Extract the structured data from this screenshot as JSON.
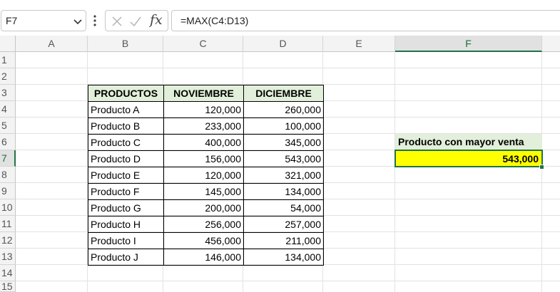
{
  "formula_bar": {
    "name_box": "F7",
    "fx_label": "fx",
    "formula": "=MAX(C4:D13)"
  },
  "columns": [
    "A",
    "B",
    "C",
    "D",
    "E",
    "F"
  ],
  "rows": [
    "1",
    "2",
    "3",
    "4",
    "5",
    "6",
    "7",
    "8",
    "9",
    "10",
    "11",
    "12",
    "13",
    "14",
    "15"
  ],
  "table": {
    "headers": [
      "PRODUCTOS",
      "NOVIEMBRE",
      "DICIEMBRE"
    ],
    "rows": [
      [
        "Producto A",
        "120,000",
        "260,000"
      ],
      [
        "Producto B",
        "233,000",
        "100,000"
      ],
      [
        "Producto C",
        "400,000",
        "345,000"
      ],
      [
        "Producto D",
        "156,000",
        "543,000"
      ],
      [
        "Producto E",
        "120,000",
        "321,000"
      ],
      [
        "Producto F",
        "145,000",
        "134,000"
      ],
      [
        "Producto G",
        "200,000",
        "54,000"
      ],
      [
        "Producto H",
        "256,000",
        "257,000"
      ],
      [
        "Producto I",
        "456,000",
        "211,000"
      ],
      [
        "Producto J",
        "146,000",
        "134,000"
      ]
    ]
  },
  "summary": {
    "label": "Producto con mayor venta",
    "value": "543,000"
  },
  "selection": {
    "cell": "F7",
    "column": "F",
    "row": "7"
  },
  "colors": {
    "header_fill": "#e2efda",
    "highlight": "#ffff00",
    "accent": "#217346"
  }
}
